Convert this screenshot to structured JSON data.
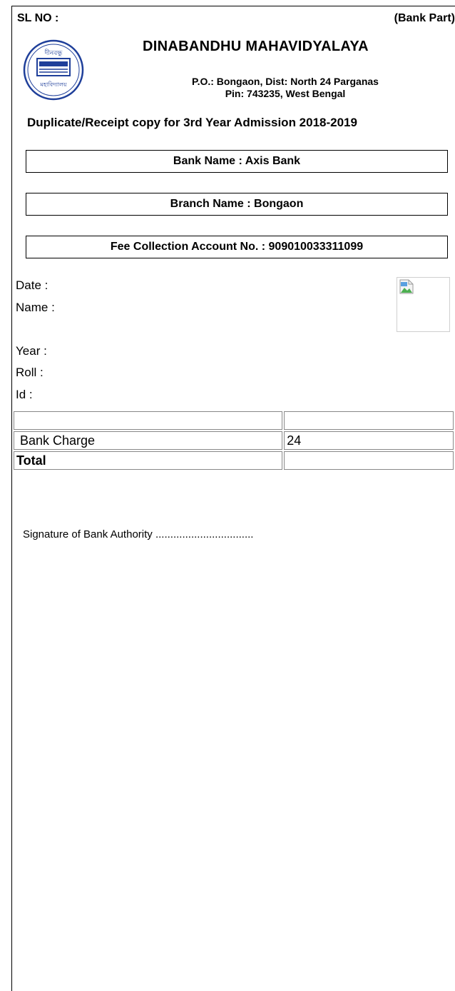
{
  "header": {
    "sl_no_label": "SL NO :",
    "part_label": "(Bank Part)",
    "college_name": "DINABANDHU MAHAVIDYALAYA",
    "address_line1": "P.O.: Bongaon, Dist: North 24 Parganas",
    "address_line2": "Pin: 743235, West Bengal",
    "logo_top_text": "দীনবন্ধু",
    "logo_bottom_text": "মহাবিদ্যালয়"
  },
  "receipt_title": "Duplicate/Receipt copy for 3rd Year Admission 2018-2019",
  "bank": {
    "bank_name": "Bank Name : Axis Bank",
    "branch_name": "Branch Name : Bongaon",
    "account_no": "Fee Collection Account No. : 909010033311099"
  },
  "student": {
    "date_label": "Date :",
    "name_label": "Name :",
    "year_label": "Year :",
    "roll_label": "Roll :",
    "id_label": "Id :"
  },
  "fees": {
    "rows": [
      {
        "label": "",
        "amount": ""
      },
      {
        "label": " Bank Charge",
        "amount": "24"
      },
      {
        "label": "Total",
        "amount": ""
      }
    ]
  },
  "signature": "Signature of Bank Authority .................................",
  "colors": {
    "logo_blue": "#1f3f9a",
    "border": "#000000"
  }
}
